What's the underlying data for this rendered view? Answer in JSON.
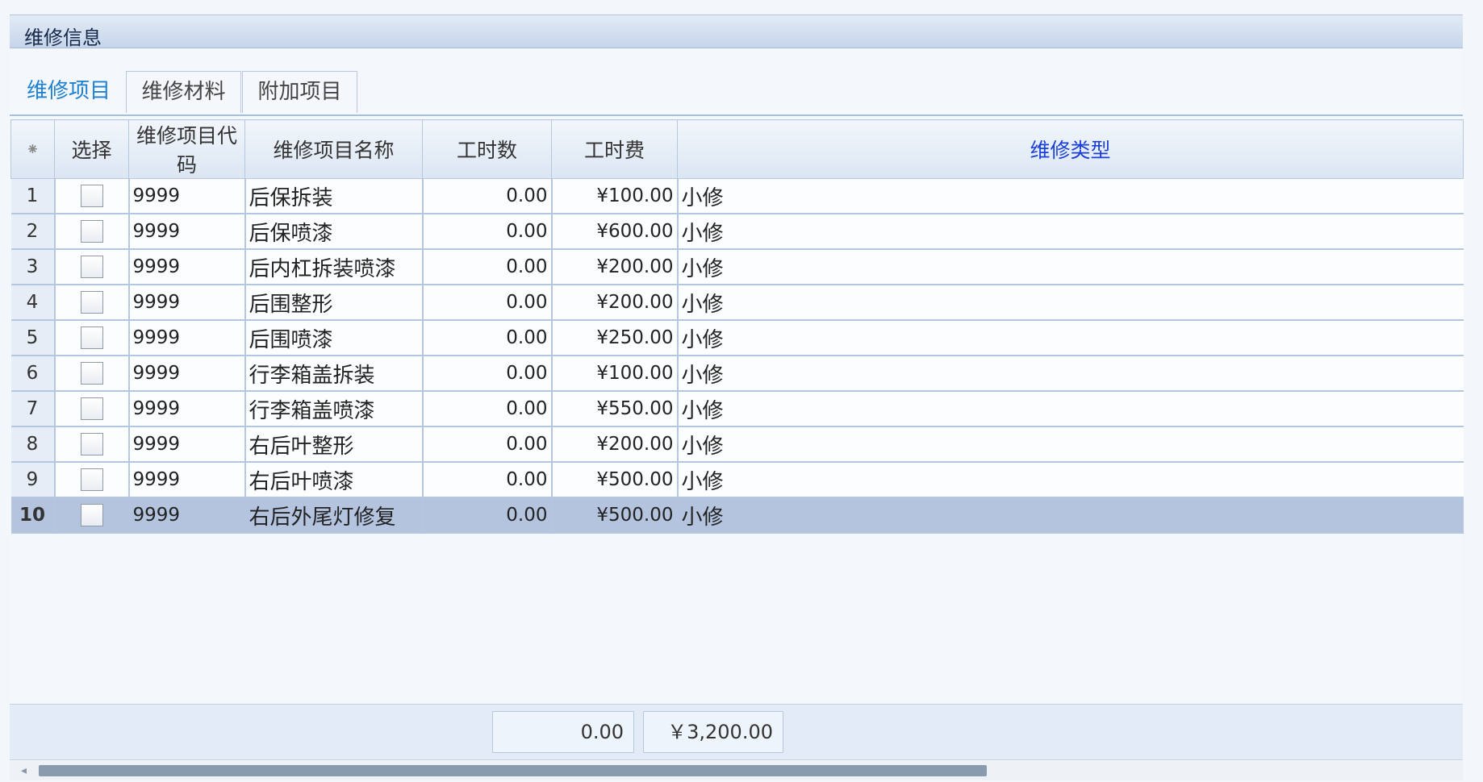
{
  "panel": {
    "title": "维修信息"
  },
  "tabs": [
    {
      "label": "维修项目",
      "active": true
    },
    {
      "label": "维修材料",
      "active": false
    },
    {
      "label": "附加项目",
      "active": false
    }
  ],
  "grid": {
    "columns": {
      "rownum": "⁕",
      "select": "选择",
      "code": "维修项目代码",
      "name": "维修项目名称",
      "hours": "工时数",
      "fee": "工时费",
      "type": "维修类型"
    },
    "rows": [
      {
        "n": "1",
        "code": "9999",
        "name": "后保拆装",
        "hours": "0.00",
        "fee": "¥100.00",
        "type": "小修"
      },
      {
        "n": "2",
        "code": "9999",
        "name": "后保喷漆",
        "hours": "0.00",
        "fee": "¥600.00",
        "type": "小修"
      },
      {
        "n": "3",
        "code": "9999",
        "name": "后内杠拆装喷漆",
        "hours": "0.00",
        "fee": "¥200.00",
        "type": "小修"
      },
      {
        "n": "4",
        "code": "9999",
        "name": "后围整形",
        "hours": "0.00",
        "fee": "¥200.00",
        "type": "小修"
      },
      {
        "n": "5",
        "code": "9999",
        "name": "后围喷漆",
        "hours": "0.00",
        "fee": "¥250.00",
        "type": "小修"
      },
      {
        "n": "6",
        "code": "9999",
        "name": "行李箱盖拆装",
        "hours": "0.00",
        "fee": "¥100.00",
        "type": "小修"
      },
      {
        "n": "7",
        "code": "9999",
        "name": "行李箱盖喷漆",
        "hours": "0.00",
        "fee": "¥550.00",
        "type": "小修"
      },
      {
        "n": "8",
        "code": "9999",
        "name": "右后叶整形",
        "hours": "0.00",
        "fee": "¥200.00",
        "type": "小修"
      },
      {
        "n": "9",
        "code": "9999",
        "name": "右后叶喷漆",
        "hours": "0.00",
        "fee": "¥500.00",
        "type": "小修"
      },
      {
        "n": "10",
        "code": "9999",
        "name": "右后外尾灯修复",
        "hours": "0.00",
        "fee": "¥500.00",
        "type": "小修",
        "selected": true
      }
    ]
  },
  "summary": {
    "hours_total": "0.00",
    "fee_total": "￥3,200.00"
  },
  "colors": {
    "accent_tab": "#1d7fd0",
    "header_blue": "#1a3fd8",
    "selected_row": "#b4c4df"
  }
}
